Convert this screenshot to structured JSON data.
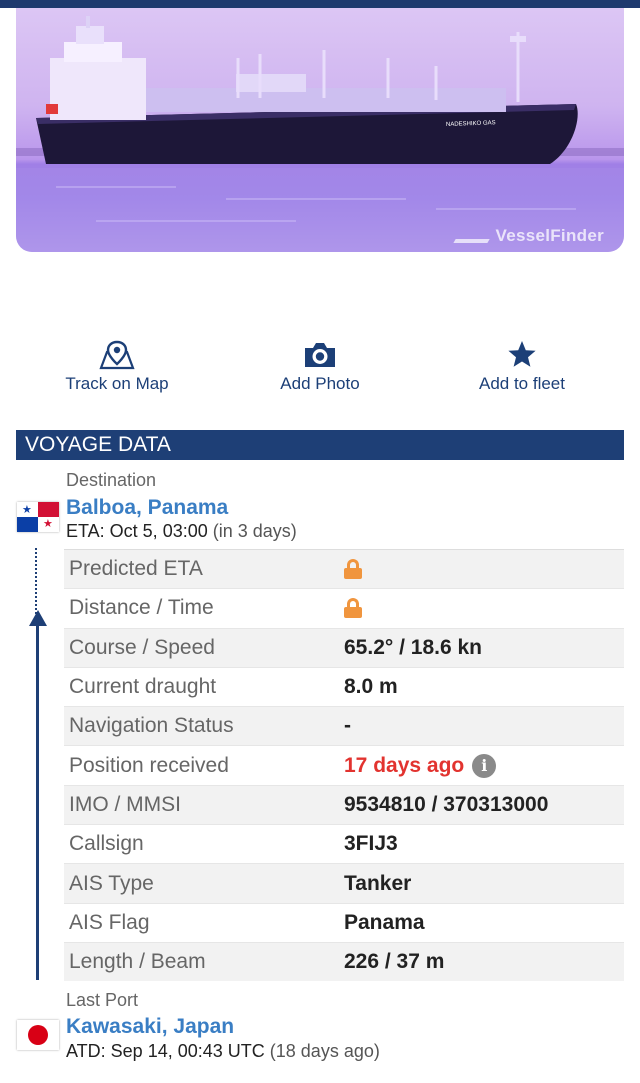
{
  "photo": {
    "watermark": "VesselFinder",
    "hull_name": "NADESHIKO GAS"
  },
  "actions": [
    {
      "label": "Track on Map",
      "icon": "map-pin-icon"
    },
    {
      "label": "Add Photo",
      "icon": "camera-icon"
    },
    {
      "label": "Add to fleet",
      "icon": "star-icon"
    }
  ],
  "section_title": "VOYAGE DATA",
  "destination": {
    "caption": "Destination",
    "port": "Balboa, Panama",
    "eta_label": "ETA: Oct 5, 03:00",
    "eta_relative": "(in 3 days)",
    "flag": "panama-flag"
  },
  "rows": [
    {
      "key": "Predicted ETA",
      "value": "",
      "locked": true
    },
    {
      "key": "Distance / Time",
      "value": "",
      "locked": true
    },
    {
      "key": "Course / Speed",
      "value": "65.2° / 18.6 kn"
    },
    {
      "key": "Current draught",
      "value": "8.0 m"
    },
    {
      "key": "Navigation Status",
      "value": "-"
    },
    {
      "key": "Position received",
      "value": "17 days ago",
      "alert": true,
      "info": true
    },
    {
      "key": "IMO / MMSI",
      "value": "9534810 / 370313000"
    },
    {
      "key": "Callsign",
      "value": "3FIJ3"
    },
    {
      "key": "AIS Type",
      "value": "Tanker"
    },
    {
      "key": "AIS Flag",
      "value": "Panama"
    },
    {
      "key": "Length / Beam",
      "value": "226 / 37 m"
    }
  ],
  "last_port": {
    "caption": "Last Port",
    "port": "Kawasaki, Japan",
    "atd_label": "ATD: Sep 14, 00:43 UTC",
    "atd_relative": "(18 days ago)",
    "flag": "japan-flag"
  },
  "colors": {
    "header_bg": "#1e3f76",
    "link": "#3a7ec4",
    "alert": "#e2332f",
    "lock": "#f0953e"
  }
}
